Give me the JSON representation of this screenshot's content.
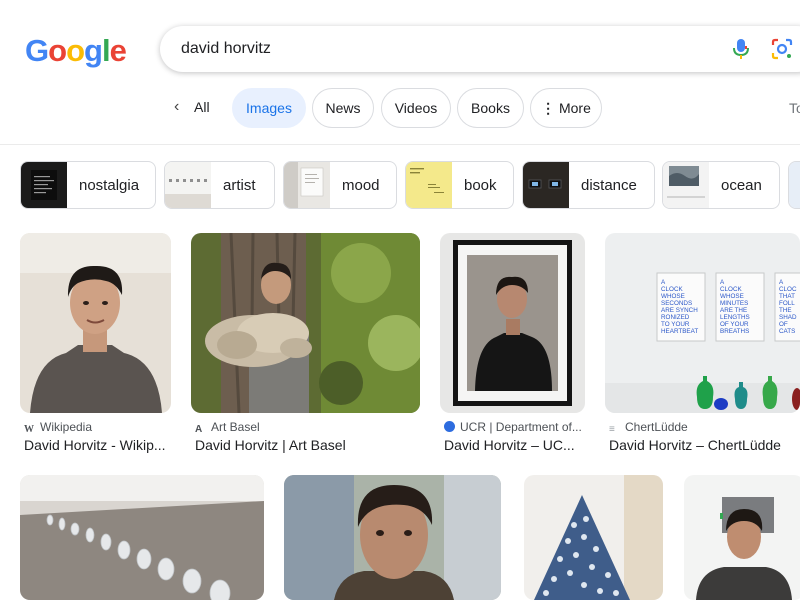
{
  "logo": {
    "letters": [
      "G",
      "o",
      "o",
      "g",
      "l",
      "e"
    ],
    "colors": [
      "#4285f4",
      "#ea4335",
      "#fbbc05",
      "#4285f4",
      "#34a853",
      "#ea4335"
    ]
  },
  "search": {
    "query": "david horvitz",
    "mic_icon": "microphone-icon",
    "lens_icon": "lens-icon"
  },
  "tabs": {
    "all": "All",
    "images": "Images",
    "news": "News",
    "videos": "Videos",
    "books": "Books",
    "more": "More",
    "overflow": "To"
  },
  "chips": [
    {
      "label": "nostalgia"
    },
    {
      "label": "artist"
    },
    {
      "label": "mood"
    },
    {
      "label": "book"
    },
    {
      "label": "distance"
    },
    {
      "label": "ocean"
    }
  ],
  "results": [
    {
      "source": "Wikipedia",
      "title": "David Horvitz - Wikip..."
    },
    {
      "source": "Art Basel",
      "title": "David Horvitz | Art Basel"
    },
    {
      "source": "UCR | Department of...",
      "title": "David Horvitz – UC..."
    },
    {
      "source": "ChertLüdde",
      "title": "David Horvitz – ChertLüdde"
    }
  ],
  "artwork_text": {
    "panel1": [
      "A",
      "CLOCK",
      "WHOSE",
      "SECONDS",
      "ARE SYNCH",
      "RONIZED",
      "TO YOUR",
      "HEARTBEAT"
    ],
    "panel2": [
      "A",
      "CLOCK",
      "WHOSE",
      "MINUTES",
      "ARE THE",
      "LENGTHS",
      "OF YOUR",
      "BREATHS"
    ],
    "panel3": [
      "A",
      "CLOC",
      "THAT",
      "FOLL",
      "THE",
      "SHAD",
      "OF",
      "CATS"
    ]
  },
  "colors": {
    "accent": "#1a73e8",
    "active_tab_bg": "#e8f0fe"
  }
}
